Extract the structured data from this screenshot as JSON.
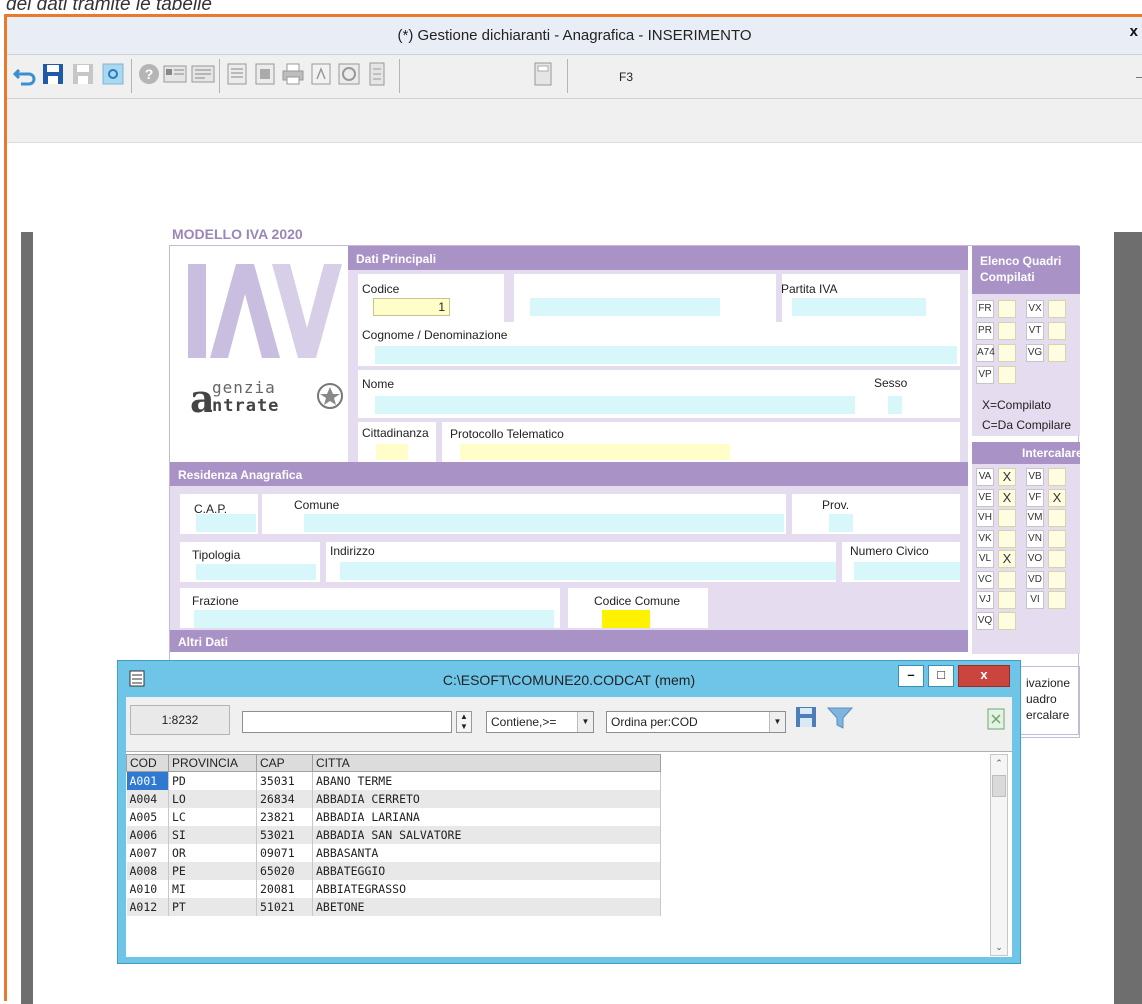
{
  "caption": "dei dati tramite le tabelle",
  "window": {
    "title": "(*) Gestione dichiaranti -  Anagrafica - INSERIMENTO",
    "close": "x"
  },
  "toolbar": {
    "buttons": [
      "undo-icon",
      "save-icon",
      "save-as-icon",
      "recycle-icon",
      "help-icon",
      "card-icon",
      "list-icon",
      "document-icon",
      "form-icon",
      "print-icon",
      "pdf-icon",
      "target-icon",
      "archive-icon",
      "calculator-icon"
    ],
    "f3_label": "F3"
  },
  "form": {
    "title": "MODELLO IVA 2020",
    "logo": {
      "letters": "IVA",
      "agency_line1": "genzia",
      "agency_line2": "ntrate"
    },
    "dati_principali": "Dati Principali",
    "codice_label": "Codice",
    "codice_value": "1",
    "partita_iva_label": "Partita IVA",
    "cognome_label": "Cognome / Denominazione",
    "nome_label": "Nome",
    "sesso_label": "Sesso",
    "cittadinanza_label": "Cittadinanza",
    "protocollo_label": "Protocollo Telematico",
    "residenza": "Residenza Anagrafica",
    "cap_label": "C.A.P.",
    "comune_label": "Comune",
    "prov_label": "Prov.",
    "tipologia_label": "Tipologia",
    "indirizzo_label": "Indirizzo",
    "civico_label": "Numero Civico",
    "frazione_label": "Frazione",
    "codice_comune_label": "Codice Comune",
    "altri_dati": "Altri Dati",
    "quadri_title_1": "Elenco Quadri",
    "quadri_title_2": "Compilati",
    "quadri_rows": [
      [
        "FR",
        "VX"
      ],
      [
        "PR",
        "VT"
      ],
      [
        "A74",
        "VG"
      ],
      [
        "VP",
        ""
      ]
    ],
    "legend_x": "X=Compilato",
    "legend_c": "C=Da Compilare",
    "intercalare_title": "Intercalare",
    "intercalare_rows": [
      {
        "a": "VA",
        "av": "X",
        "b": "VB",
        "bv": ""
      },
      {
        "a": "VE",
        "av": "X",
        "b": "VF",
        "bv": "X"
      },
      {
        "a": "VH",
        "av": "",
        "b": "VM",
        "bv": ""
      },
      {
        "a": "VK",
        "av": "",
        "b": "VN",
        "bv": ""
      },
      {
        "a": "VL",
        "av": "X",
        "b": "VO",
        "bv": ""
      },
      {
        "a": "VC",
        "av": "",
        "b": "VD",
        "bv": ""
      },
      {
        "a": "VJ",
        "av": "",
        "b": "VI",
        "bv": ""
      },
      {
        "a": "VQ",
        "av": "",
        "b": "",
        "bv": ""
      }
    ],
    "side_text": [
      "ivazione",
      "uadro",
      "ercalare"
    ]
  },
  "lookup": {
    "title": "C:\\ESOFT\\COMUNE20.CODCAT (mem)",
    "minimize": "–",
    "maximize": "□",
    "close": "x",
    "count": "1:8232",
    "search_value": "",
    "match_mode": "Contiene,>=",
    "order_by": "Ordina per:COD",
    "columns": [
      "COD",
      "PROVINCIA",
      "CAP",
      "CITTA"
    ],
    "rows": [
      [
        "A001",
        "PD",
        "35031",
        "ABANO TERME"
      ],
      [
        "A004",
        "LO",
        "26834",
        "ABBADIA CERRETO"
      ],
      [
        "A005",
        "LC",
        "23821",
        "ABBADIA LARIANA"
      ],
      [
        "A006",
        "SI",
        "53021",
        "ABBADIA SAN SALVATORE"
      ],
      [
        "A007",
        "OR",
        "09071",
        "ABBASANTA"
      ],
      [
        "A008",
        "PE",
        "65020",
        "ABBATEGGIO"
      ],
      [
        "A010",
        "MI",
        "20081",
        "ABBIATEGRASSO"
      ],
      [
        "A012",
        "PT",
        "51021",
        "ABETONE"
      ]
    ]
  }
}
